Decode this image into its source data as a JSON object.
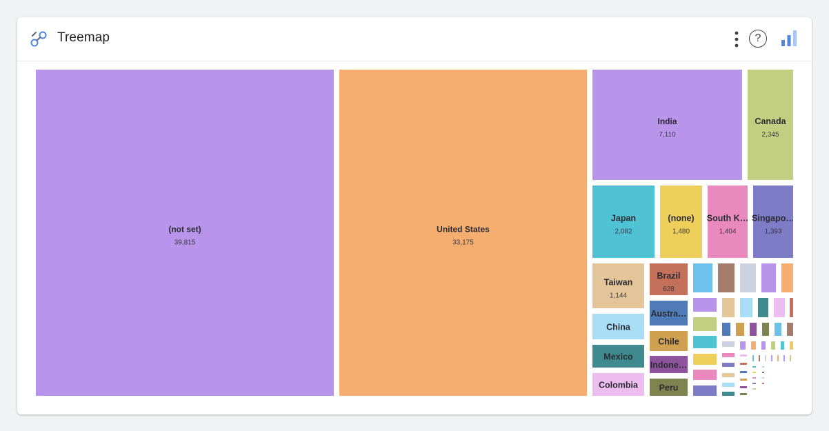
{
  "header": {
    "title": "Treemap",
    "logo_icon": "analytics-icon",
    "menu_icon": "more-vert-icon",
    "help_icon": "help-icon",
    "help_glyph": "?",
    "chart_type_icon": "bar-chart-icon"
  },
  "chart_data": {
    "type": "treemap",
    "title": "",
    "items": [
      {
        "label": "(not set)",
        "value": 39815,
        "display": "39,815",
        "color": "#b894ea"
      },
      {
        "label": "United States",
        "value": 33175,
        "display": "33,175",
        "color": "#f5ae6f"
      },
      {
        "label": "India",
        "value": 7110,
        "display": "7,110",
        "color": "#b894ea"
      },
      {
        "label": "Canada",
        "value": 2345,
        "display": "2,345",
        "color": "#c2cf80"
      },
      {
        "label": "Japan",
        "value": 2082,
        "display": "2,082",
        "color": "#4fc3d4"
      },
      {
        "label": "(none)",
        "value": 1480,
        "display": "1,480",
        "color": "#eecf5b"
      },
      {
        "label": "South K…",
        "value": 1404,
        "display": "1,404",
        "color": "#ea89bd"
      },
      {
        "label": "Singapo…",
        "value": 1393,
        "display": "1,393",
        "color": "#7e7cc7"
      },
      {
        "label": "Taiwan",
        "value": 1144,
        "display": "1,144",
        "color": "#e4c59a"
      },
      {
        "label": "Brazil",
        "value": 628,
        "display": "628",
        "color": "#c4705a"
      },
      {
        "label": "China",
        "display": "",
        "color": "#a8def5"
      },
      {
        "label": "Austra…",
        "display": "",
        "color": "#4f7bb8"
      },
      {
        "label": "Chile",
        "display": "",
        "color": "#cfa04f"
      },
      {
        "label": "Mexico",
        "display": "",
        "color": "#3e8a8e"
      },
      {
        "label": "Indone…",
        "display": "",
        "color": "#8e539c"
      },
      {
        "label": "Colombia",
        "display": "",
        "color": "#eebdf0"
      },
      {
        "label": "Peru",
        "display": "",
        "color": "#7e844f"
      }
    ],
    "minor_palette": [
      "#6ec1ea",
      "#a47d6c",
      "#cdd2e3",
      "#b894ea",
      "#f5ae6f",
      "#b894ea",
      "#c2cf80",
      "#4fc3d4",
      "#eecf5b",
      "#ea89bd",
      "#7e7cc7",
      "#e4c59a",
      "#a8def5",
      "#3e8a8e",
      "#eebdf0",
      "#c4705a",
      "#4f7bb8",
      "#cfa04f",
      "#8e539c",
      "#7e844f"
    ]
  }
}
